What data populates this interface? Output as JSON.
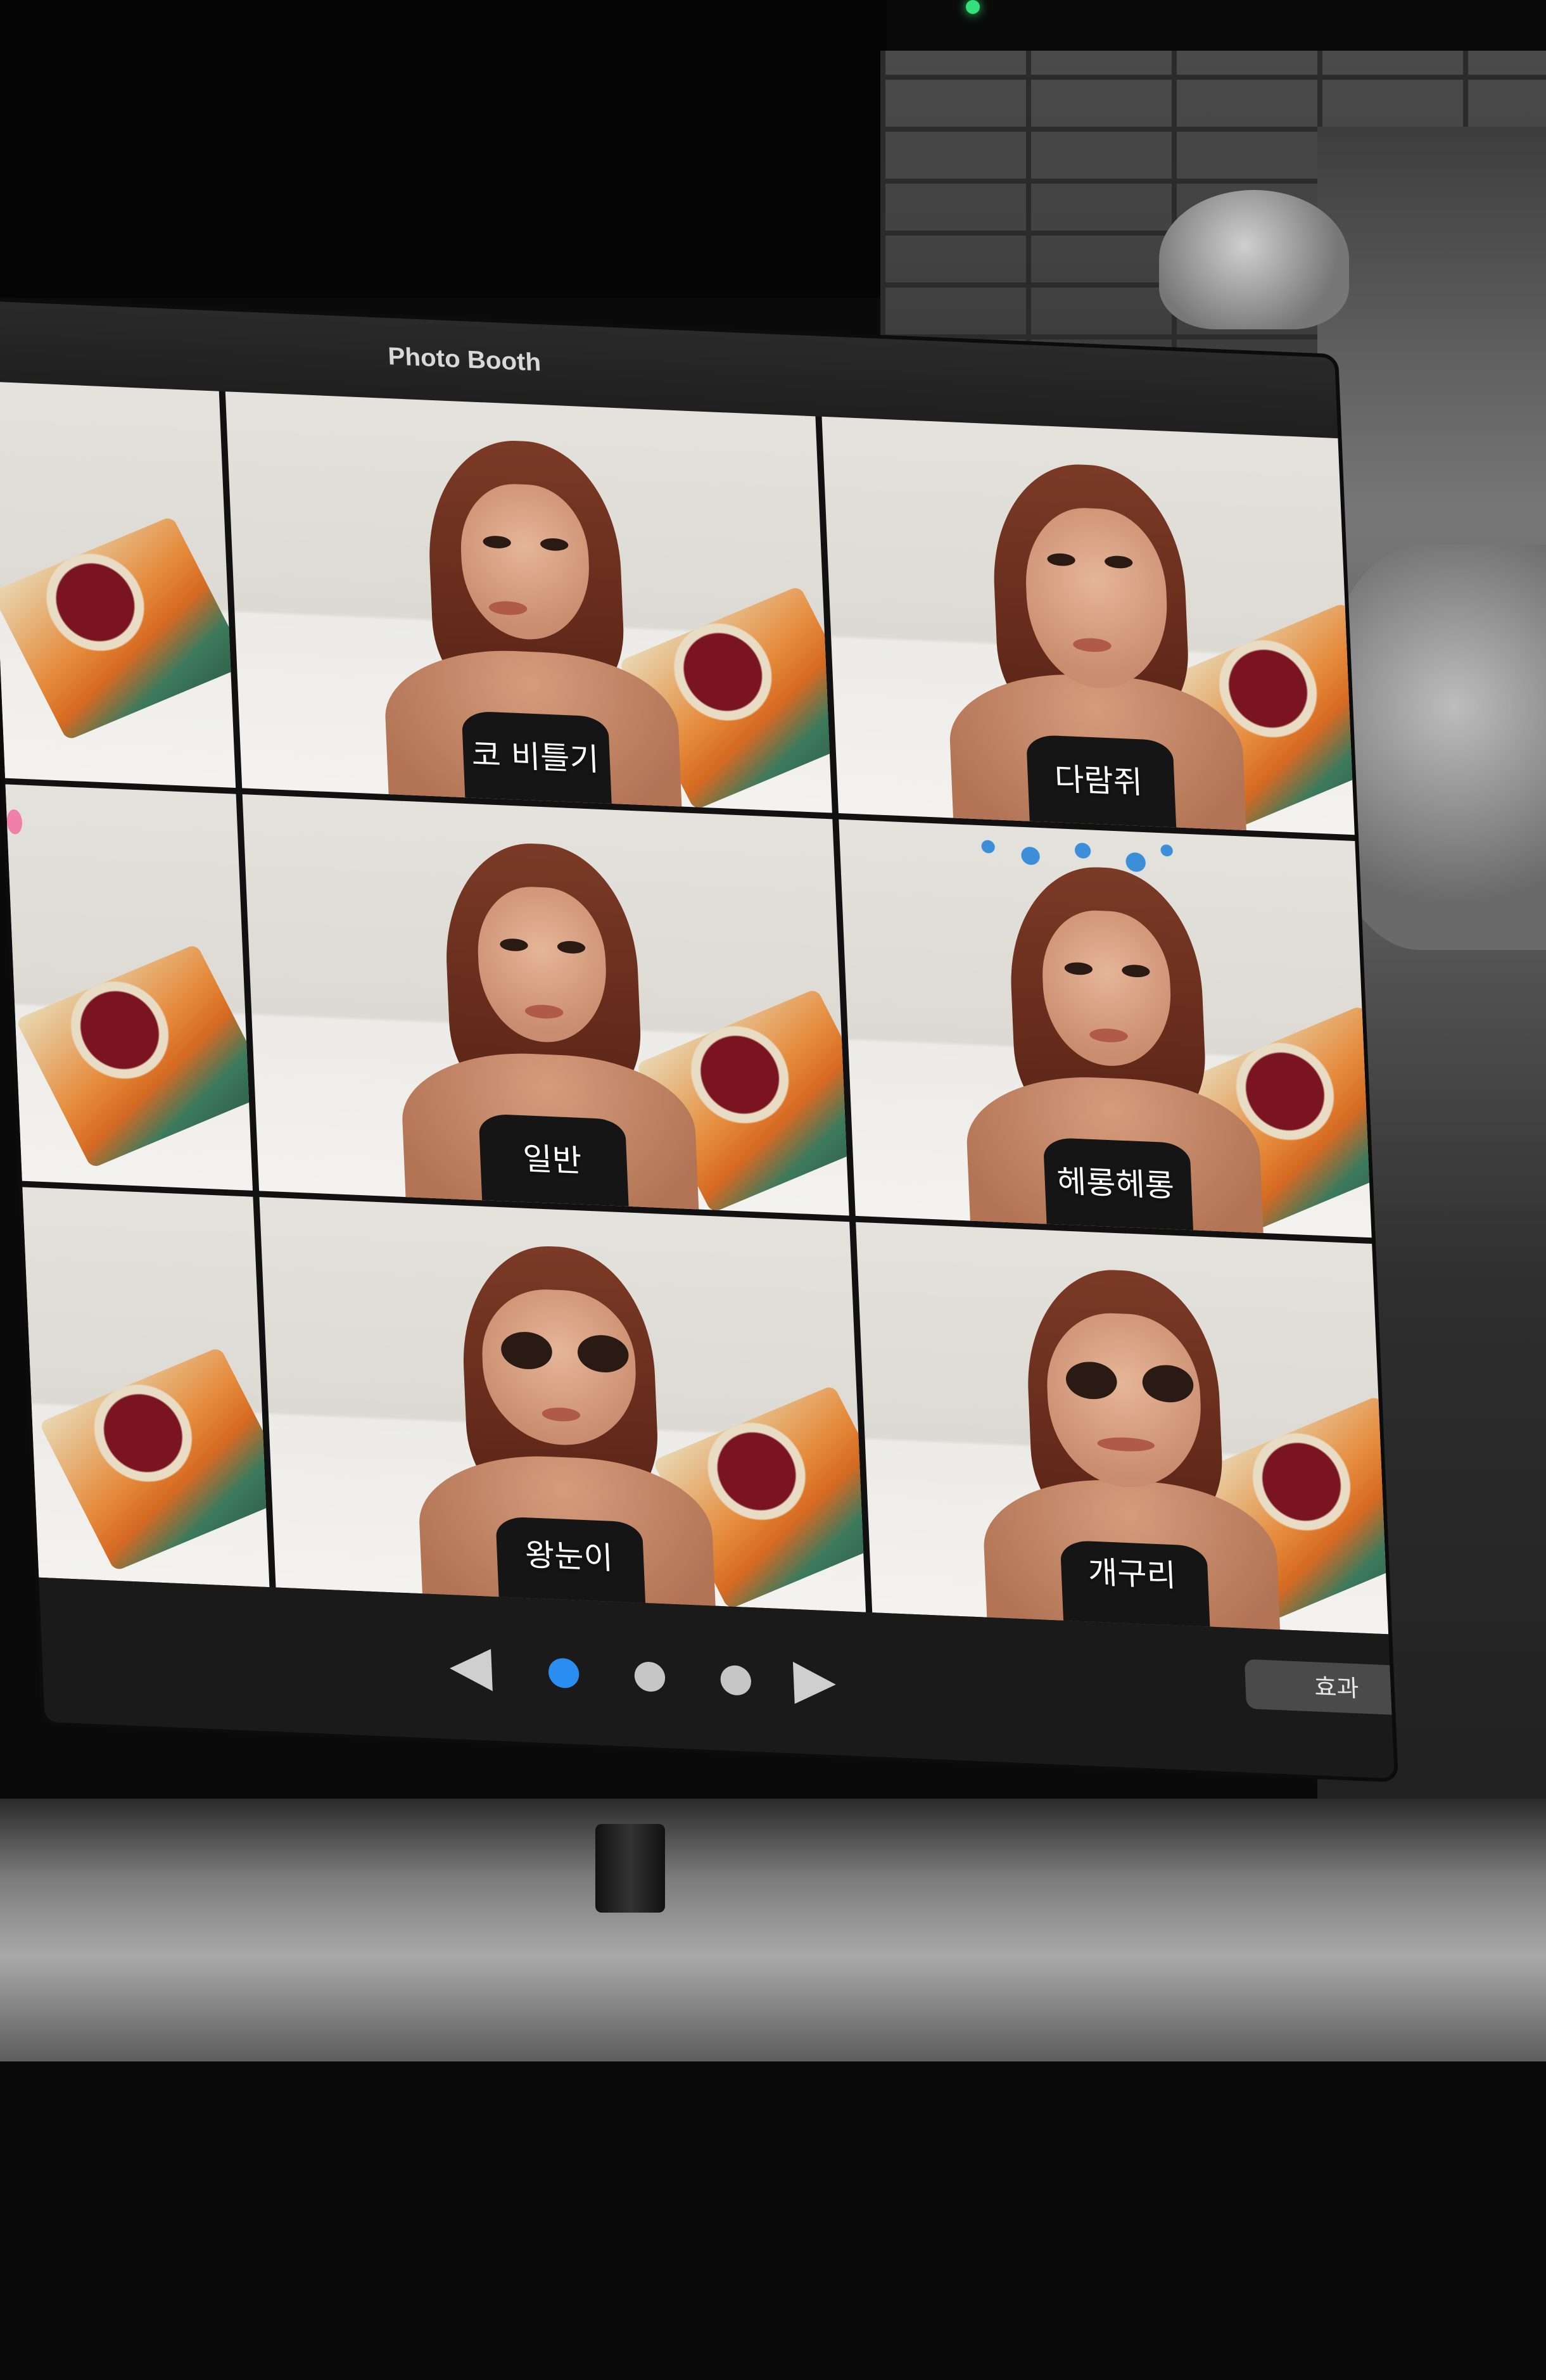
{
  "window": {
    "title": "Photo Booth"
  },
  "effects": [
    {
      "label": "",
      "selected": false
    },
    {
      "label": "코 비틀기",
      "selected": false
    },
    {
      "label": "다람쥐",
      "selected": false
    },
    {
      "label": "",
      "selected": false
    },
    {
      "label": "일반",
      "selected": true
    },
    {
      "label": "헤롱헤롱",
      "selected": false
    },
    {
      "label": "",
      "selected": false
    },
    {
      "label": "왕눈이",
      "selected": false
    },
    {
      "label": "개구리",
      "selected": false
    }
  ],
  "pagination": {
    "pages": 3,
    "current_page": 1,
    "prev_icon": "triangle-left",
    "next_icon": "triangle-right"
  },
  "toolbar": {
    "effects_label": "효과"
  },
  "colors": {
    "active_dot": "#2a8ef0",
    "inactive_dot": "#c6c6c6",
    "window_bg": "#1e1e1e"
  },
  "camera_indicator": {
    "color": "#35e07a"
  }
}
